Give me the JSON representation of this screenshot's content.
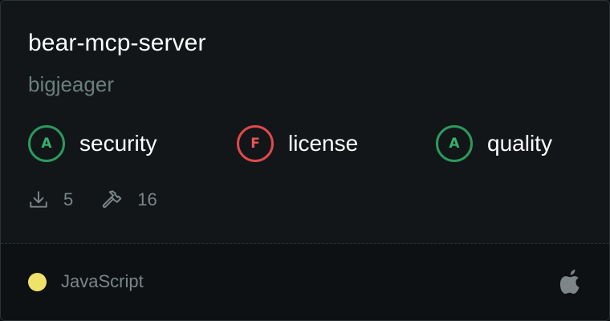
{
  "package": {
    "name": "bear-mcp-server",
    "owner": "bigjeager"
  },
  "scores": [
    {
      "grade": "A",
      "label": "security",
      "status": "pass",
      "color": "#2b9a5d"
    },
    {
      "grade": "F",
      "label": "license",
      "status": "fail",
      "color": "#e0494b"
    },
    {
      "grade": "A",
      "label": "quality",
      "status": "pass",
      "color": "#2b9a5d"
    }
  ],
  "stats": {
    "downloads": {
      "icon": "download-icon",
      "value": "5"
    },
    "tools": {
      "icon": "hammer-icon",
      "value": "16"
    }
  },
  "footer": {
    "language": "JavaScript",
    "language_color": "#efe26a",
    "platform_icon": "apple-icon"
  }
}
